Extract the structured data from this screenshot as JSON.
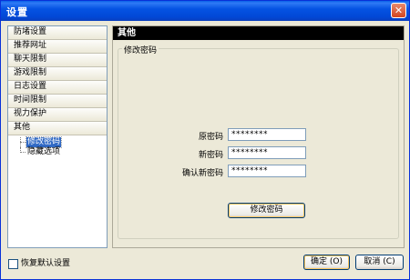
{
  "window": {
    "title": "设置",
    "close_glyph": "✕"
  },
  "categories": [
    {
      "label": "防堵设置"
    },
    {
      "label": "推荐网址"
    },
    {
      "label": "聊天限制"
    },
    {
      "label": "游戏限制"
    },
    {
      "label": "日志设置"
    },
    {
      "label": "时间限制"
    },
    {
      "label": "视力保护"
    },
    {
      "label": "其他"
    }
  ],
  "tree": [
    {
      "label": "修改密码",
      "selected": true
    },
    {
      "label": "隐藏选项",
      "selected": false
    }
  ],
  "panel": {
    "header": "其他",
    "group_title": "修改密码",
    "fields": [
      {
        "label": "原密码",
        "value": "********"
      },
      {
        "label": "新密码",
        "value": "********"
      },
      {
        "label": "确认新密码",
        "value": "********"
      }
    ],
    "change_button": "修改密码"
  },
  "footer": {
    "restore_defaults": "恢复默认设置",
    "restore_checked": false,
    "ok": "确定 (O)",
    "cancel": "取消 (C)"
  }
}
